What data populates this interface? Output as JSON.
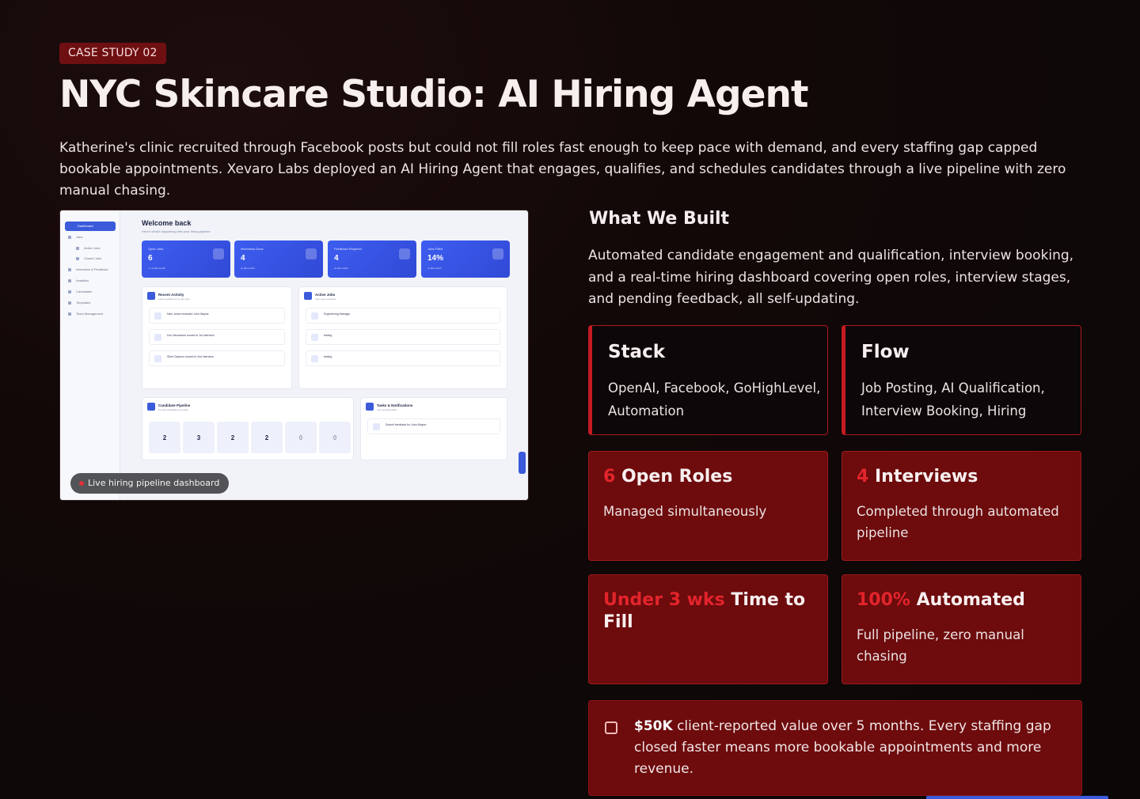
{
  "badge": "CASE STUDY 02",
  "title": "NYC Skincare Studio: AI Hiring Agent",
  "intro": "Katherine's clinic recruited through Facebook posts but could not fill roles fast enough to keep pace with demand, and every staffing gap capped bookable appointments. Xevaro Labs deployed an AI Hiring Agent that engages, qualifies, and schedules candidates through a live pipeline with zero manual chasing.",
  "screenshot": {
    "caption": "Live hiring pipeline dashboard",
    "welcome": "Welcome back",
    "welcome_sub": "Here's what's happening with your hiring pipeline",
    "sidebar": [
      "Jobs",
      "Active Jobs",
      "Closed Jobs",
      "Interviews & Feedback",
      "Analytics",
      "Candidates",
      "Templates",
      "Team Management"
    ],
    "sidebar_active": "Dashboard",
    "kpis": [
      {
        "label": "Open Jobs",
        "value": "6",
        "sub": "+7 vs last month"
      },
      {
        "label": "Interviews Done",
        "value": "4",
        "sub": "vs last month"
      },
      {
        "label": "Feedback Required",
        "value": "4",
        "sub": "vs last month"
      },
      {
        "label": "Jobs Filled",
        "value": "14%",
        "sub": "vs last month"
      }
    ],
    "recent_activity": {
      "title": "Recent Activity",
      "sub": "Latest updates from your jobs",
      "rows": [
        "New Jones reviewed John Wayne",
        "Doc Woodward moved to 1st interview",
        "Sheri Dawson moved to 2nd interview"
      ]
    },
    "active_jobs": {
      "title": "Active Jobs",
      "sub": "Your open positions",
      "rows": [
        "Engineering Manager",
        "testing",
        "testing"
      ]
    },
    "pipeline": {
      "title": "Candidate Pipeline",
      "sub": "Current candidates by stage",
      "values": [
        "2",
        "3",
        "2",
        "2",
        "0",
        "0"
      ]
    },
    "tasks": {
      "title": "Tasks & Notifications",
      "sub": "Your pending tasks",
      "rows": [
        "Submit feedback for John Wayne"
      ]
    }
  },
  "what_we_built": {
    "title": "What We Built",
    "text": "Automated candidate engagement and qualification, interview booking, and a real-time hiring dashboard covering open roles, interview stages, and pending feedback, all self-updating."
  },
  "cards": {
    "stack": {
      "title": "Stack",
      "body": "OpenAI, Facebook, GoHighLevel, Automation"
    },
    "flow": {
      "title": "Flow",
      "body": "Job Posting, AI Qualification, Interview Booking, Hiring"
    },
    "open_roles": {
      "num": "6",
      "label": "Open Roles",
      "body": "Managed simultaneously"
    },
    "interviews": {
      "num": "4",
      "label": "Interviews",
      "body": "Completed through automated pipeline"
    },
    "time_to_fill": {
      "num": "Under 3 wks",
      "label": "Time to Fill",
      "body": ""
    },
    "automated": {
      "num": "100%",
      "label": "Automated",
      "body": "Full pipeline, zero manual chasing"
    }
  },
  "value": {
    "amount": "$50K",
    "text": "client-reported value over 5 months. Every staffing gap closed faster means more bookable appointments and more revenue."
  },
  "colors": {
    "accent": "#e3242b",
    "card_red": "#6d0b0d",
    "background": "#0b0707",
    "dashboard_blue": "#3b5bdb"
  }
}
